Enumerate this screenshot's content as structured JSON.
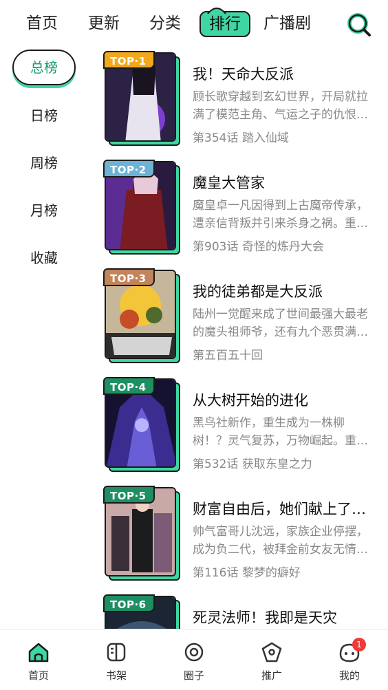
{
  "top_tabs": [
    {
      "label": "首页"
    },
    {
      "label": "更新"
    },
    {
      "label": "分类"
    },
    {
      "label": "排行"
    },
    {
      "label": "广播剧"
    }
  ],
  "sidebar": {
    "items": [
      {
        "label": "总榜"
      },
      {
        "label": "日榜"
      },
      {
        "label": "周榜"
      },
      {
        "label": "月榜"
      },
      {
        "label": "收藏"
      }
    ]
  },
  "rank_list": [
    {
      "rank_label": "TOP·1",
      "title": "我！天命大反派",
      "desc": "顾长歌穿越到玄幻世界，开局就拉满了模范主角、气运之子的仇恨…",
      "chapter": "第354话 踏入仙域"
    },
    {
      "rank_label": "TOP·2",
      "title": "魔皇大管家",
      "desc": "魔皇卓一凡因得到上古魔帝传承，遭亲信背叛并引来杀身之祸。重…",
      "chapter": "第903话 奇怪的炼丹大会"
    },
    {
      "rank_label": "TOP·3",
      "title": "我的徒弟都是大反派",
      "desc": "陆州一觉醒来成了世间最强大最老的魔头祖师爷，还有九个恶贯满…",
      "chapter": "第五百五十回"
    },
    {
      "rank_label": "TOP·4",
      "title": "从大树开始的进化",
      "desc": "黑鸟社新作，重生成为一株柳树！？灵气复苏，万物崛起。重…",
      "chapter": "第532话 获取东皇之力"
    },
    {
      "rank_label": "TOP·5",
      "title": "财富自由后，她们献上了…",
      "desc": "帅气富哥儿沈远，家族企业停摆，成为负二代，被拜金前女友无情…",
      "chapter": "第116话 黎梦的癖好"
    },
    {
      "rank_label": "TOP·6",
      "title": "死灵法师！我即是天灾",
      "desc": "",
      "chapter": ""
    }
  ],
  "bottom_nav": [
    {
      "label": "首页",
      "icon": "home-icon"
    },
    {
      "label": "书架",
      "icon": "bookshelf-icon"
    },
    {
      "label": "圈子",
      "icon": "circle-icon"
    },
    {
      "label": "推广",
      "icon": "promote-icon"
    },
    {
      "label": "我的",
      "icon": "profile-icon",
      "badge": "1"
    }
  ],
  "colors": {
    "accent": "#3fd6a3",
    "accent_text": "#199b6f",
    "badge_top1": "#f2a81d",
    "badge_top2": "#6cb2d6",
    "badge_top3": "#c2845a",
    "badge_other": "#1e8f63",
    "notification": "#f03a3a"
  }
}
